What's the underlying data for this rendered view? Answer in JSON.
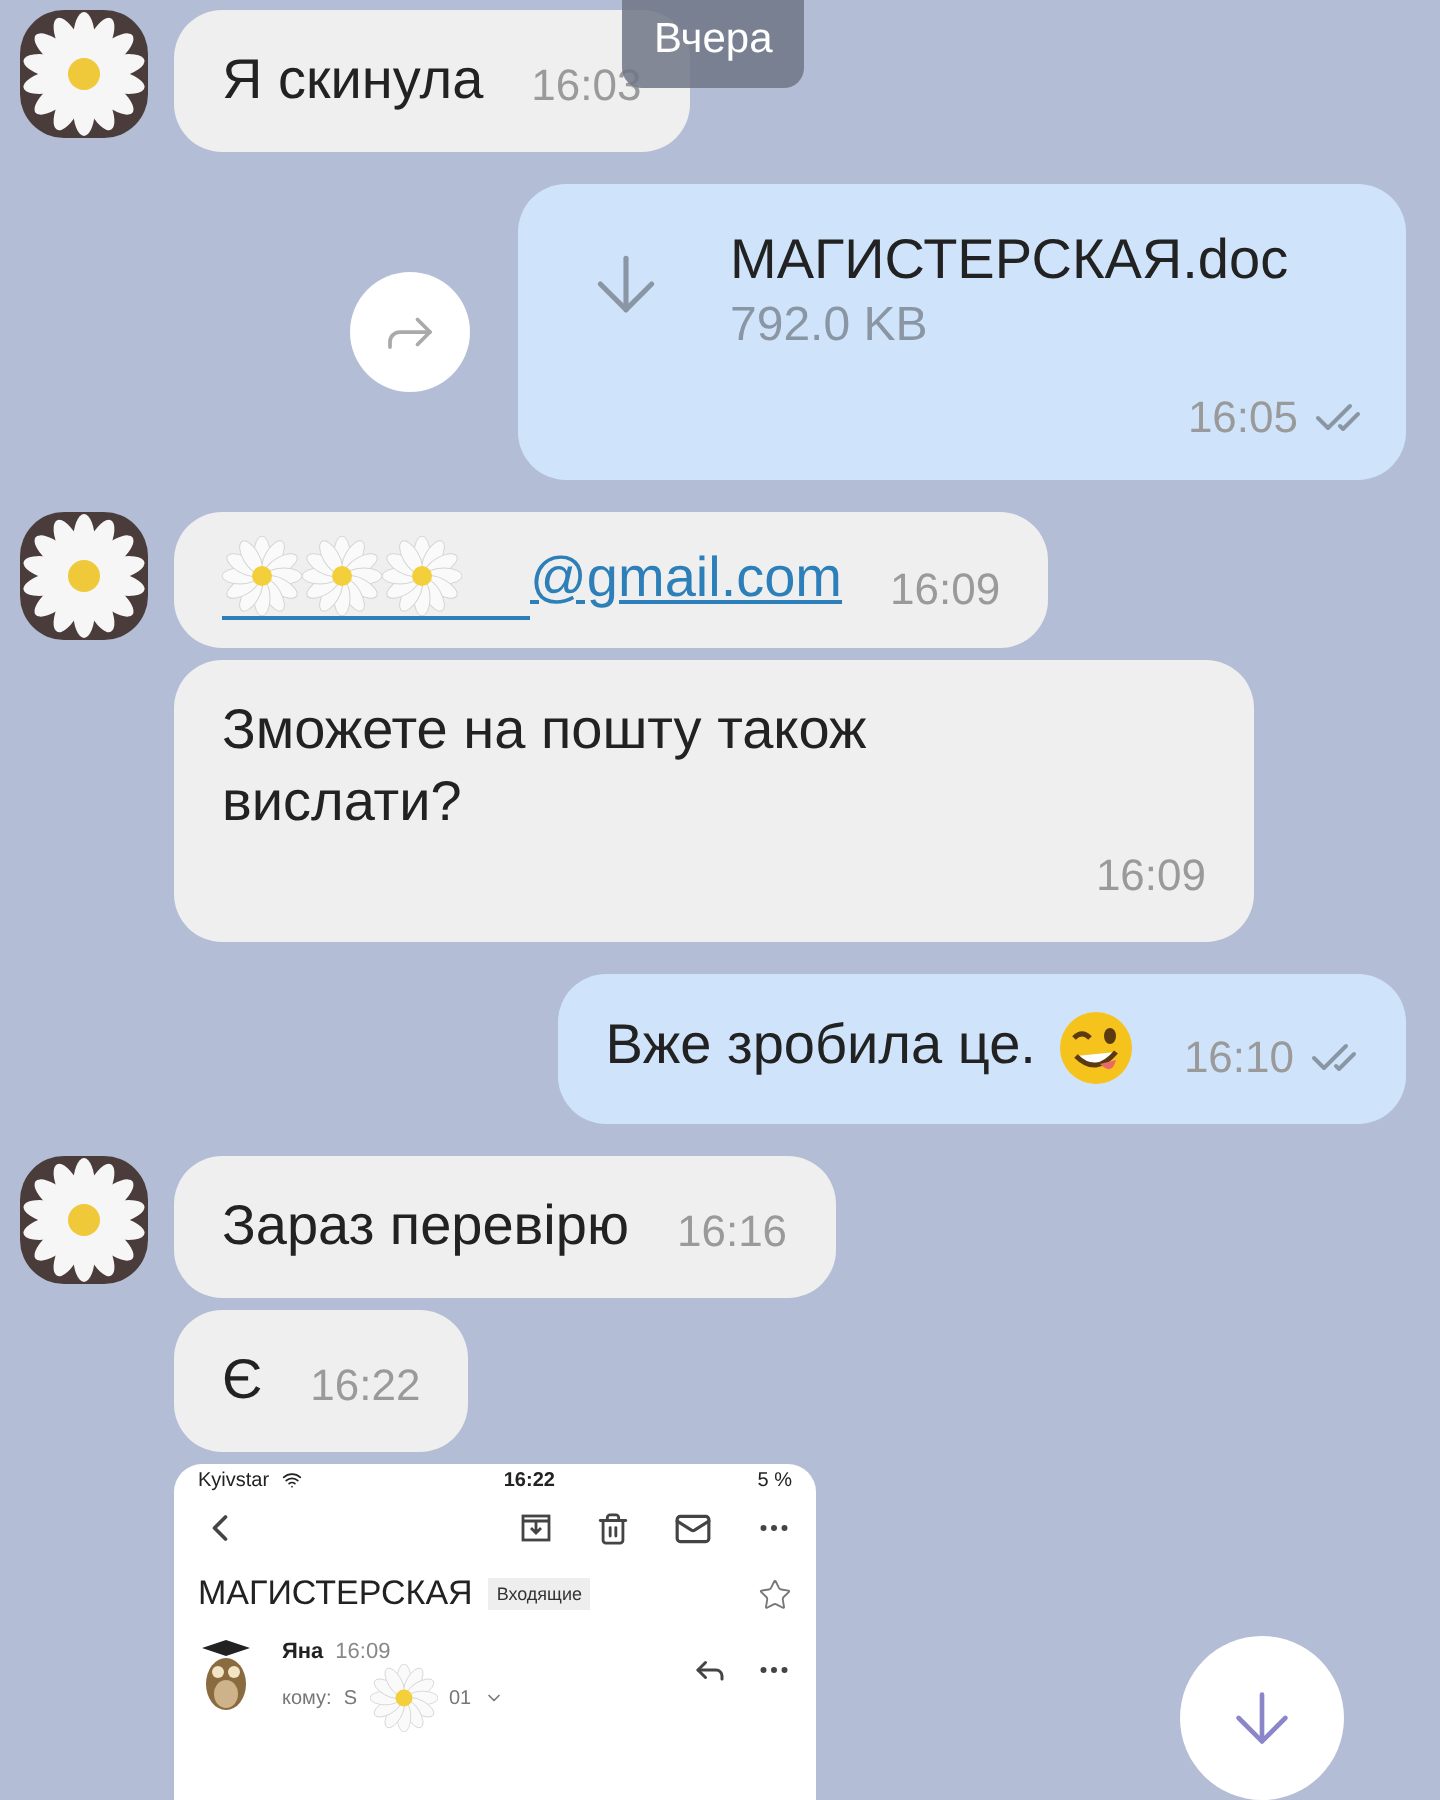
{
  "date_badge": "Вчера",
  "messages": [
    {
      "kind": "text",
      "outgoing": false,
      "avatar": true,
      "text": "Я скинула",
      "time": "16:03"
    },
    {
      "kind": "file",
      "outgoing": true,
      "file_name": "МАГИСТЕРСКАЯ.doc",
      "size": "792.0 KB",
      "time": "16:05",
      "read": true
    },
    {
      "kind": "email",
      "outgoing": false,
      "avatar": true,
      "text": "@gmail.com",
      "time": "16:09"
    },
    {
      "kind": "text",
      "outgoing": false,
      "avatar": false,
      "text": "Зможете на пошту також вислати?",
      "time": "16:09"
    },
    {
      "kind": "text",
      "outgoing": true,
      "text": "Вже зробила це.",
      "winking_emoji": true,
      "time": "16:10",
      "read": true
    },
    {
      "kind": "text",
      "outgoing": false,
      "avatar": true,
      "text": "Зараз перевірю",
      "time": "16:16"
    },
    {
      "kind": "text",
      "outgoing": false,
      "avatar": false,
      "text": "Є",
      "time": "16:22"
    },
    {
      "kind": "screenshot",
      "outgoing": false,
      "avatar": false,
      "screenshot": {
        "carrier": "Kyivstar",
        "clock": "16:22",
        "battery": "5 %",
        "subject": "МАГИСТЕРСКАЯ",
        "folder": "Входящие",
        "sender": "Яна",
        "sent_time": "16:09",
        "to_label": "кому:",
        "to_value": "S",
        "to_suffix": "01"
      }
    }
  ]
}
